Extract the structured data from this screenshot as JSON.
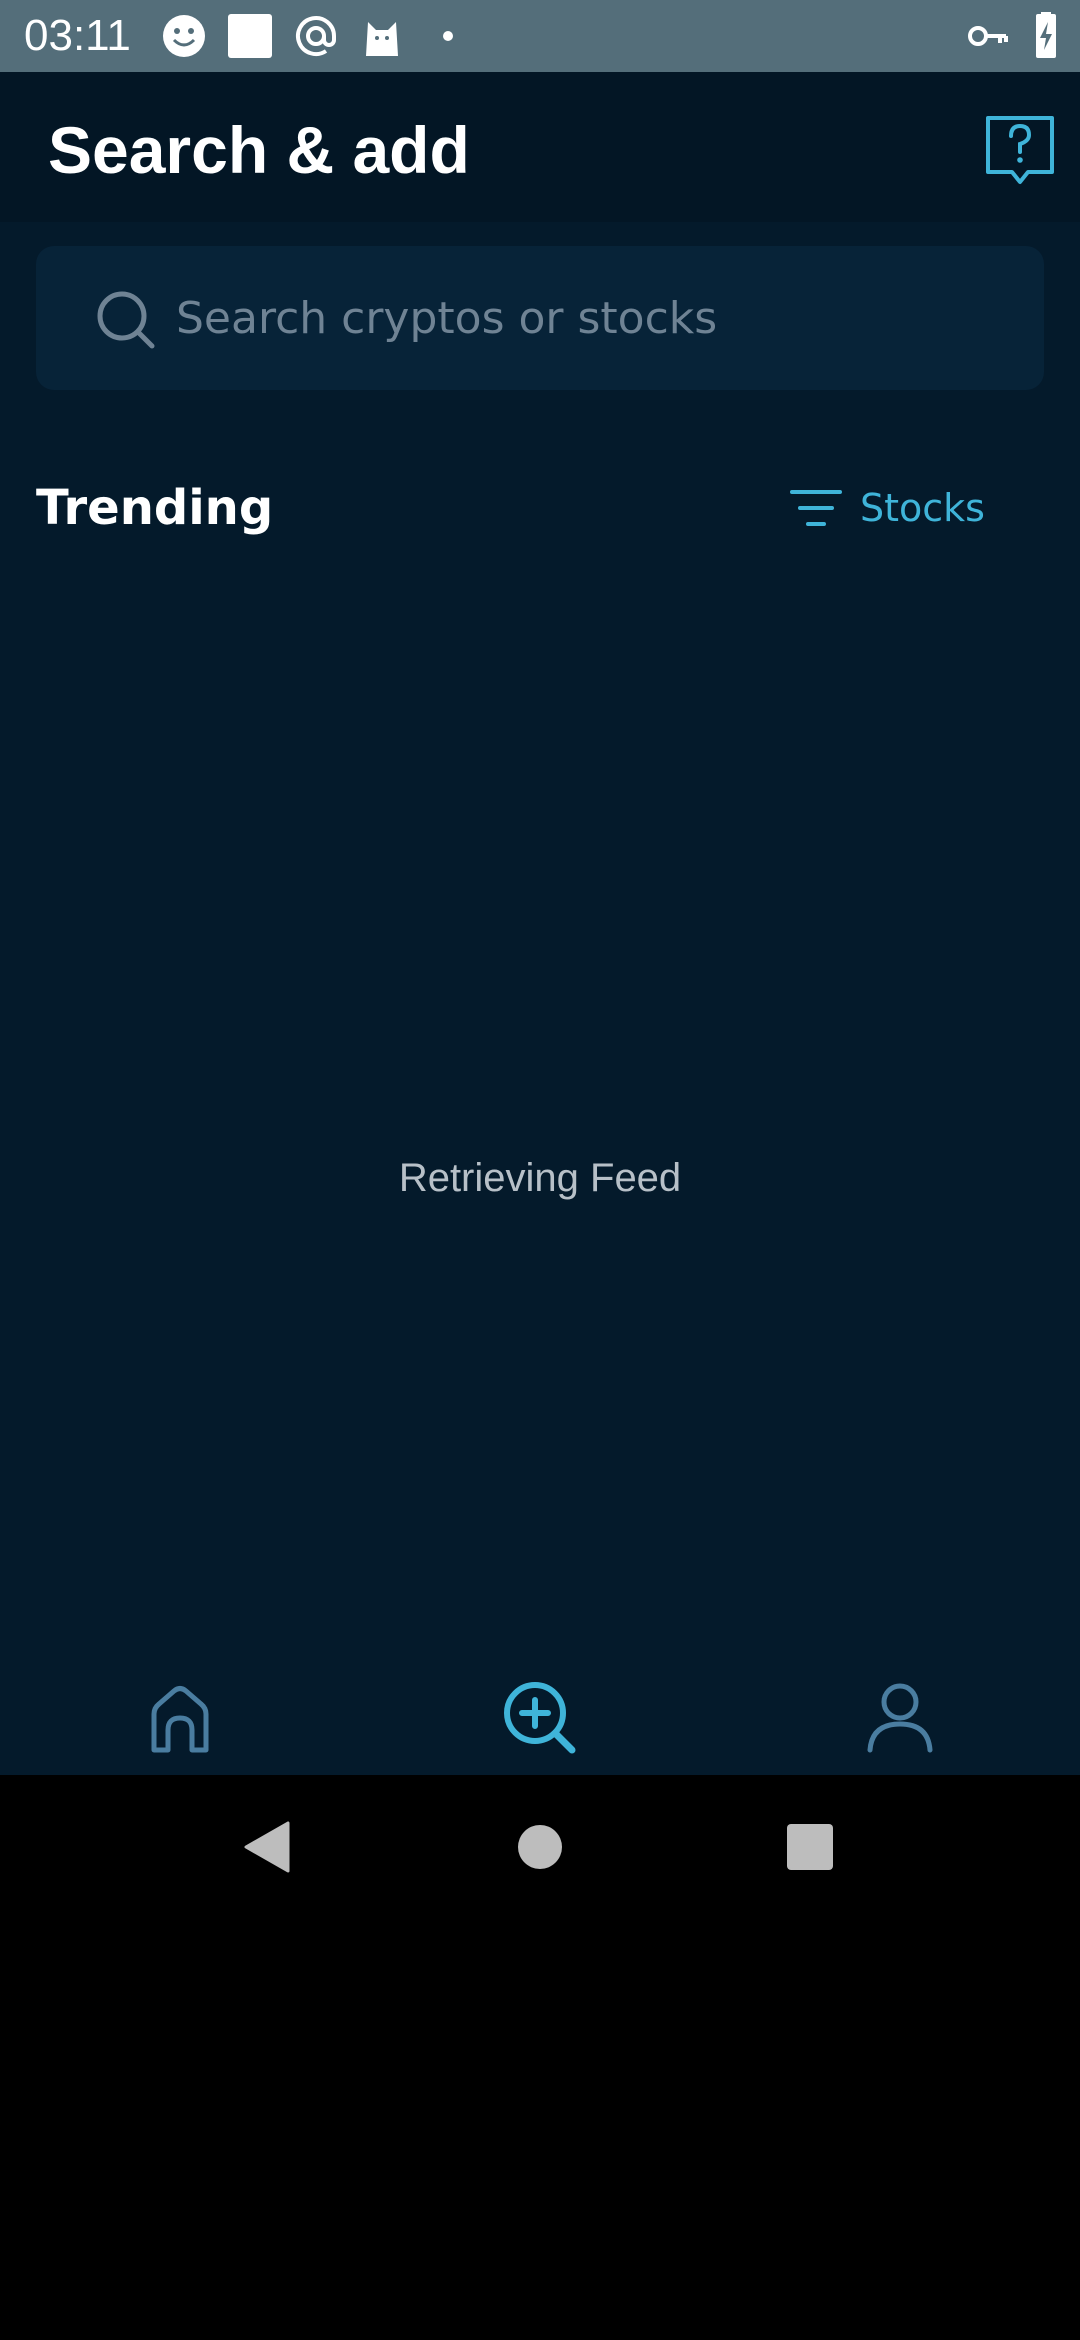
{
  "status_bar": {
    "time": "03:11",
    "icons": [
      "smiley-icon",
      "square-icon",
      "at-icon",
      "cat-icon",
      "dot-icon",
      "key-icon",
      "battery-charging-icon"
    ]
  },
  "header": {
    "title": "Search & add",
    "help_icon": "question-bubble-icon"
  },
  "search": {
    "placeholder": "Search cryptos or stocks",
    "value": ""
  },
  "trending": {
    "title": "Trending",
    "filter_label": "Stocks"
  },
  "feed": {
    "status": "Retrieving Feed"
  },
  "bottom_nav": {
    "items": [
      "home-icon",
      "search-add-icon",
      "profile-icon"
    ],
    "active": "search-add-icon"
  },
  "colors": {
    "background": "#041a2b",
    "header": "#031625",
    "search_box": "#072338",
    "accent": "#3fb4d9",
    "inactive_icon": "#4a7da0",
    "status_bar": "#546e7a"
  }
}
